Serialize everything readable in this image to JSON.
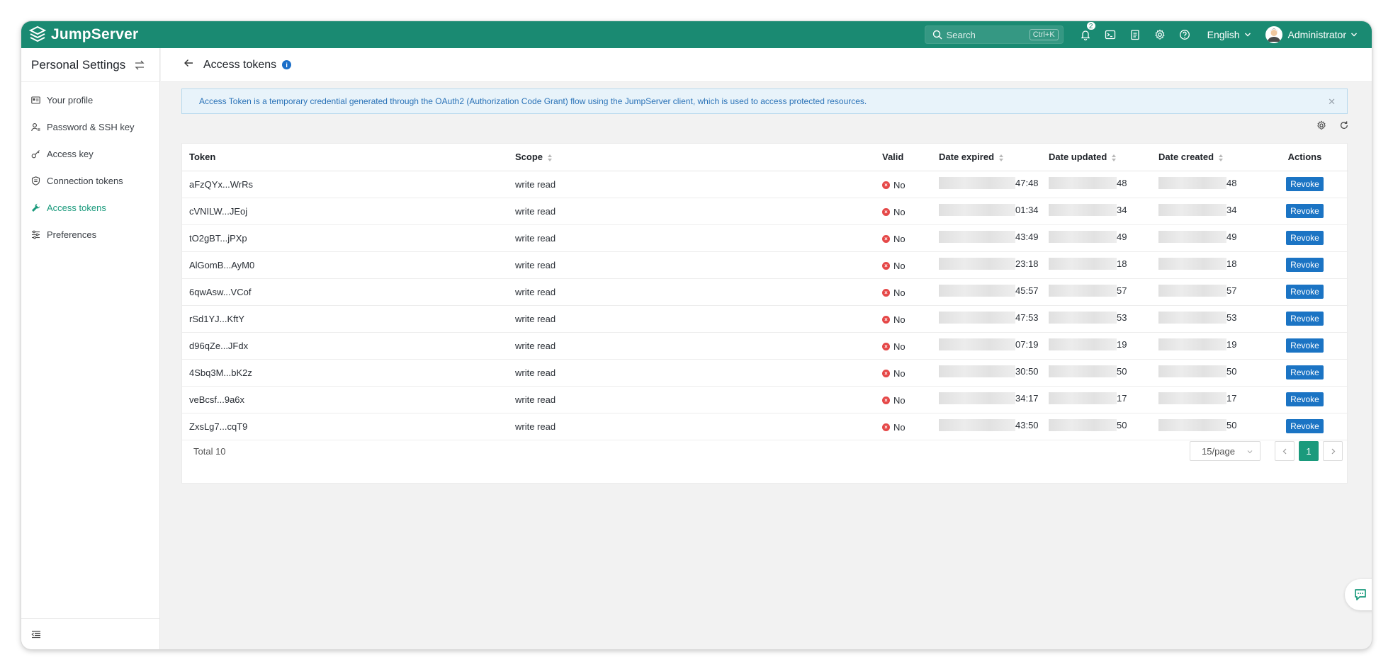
{
  "app": {
    "brand": "JumpServer"
  },
  "topbar": {
    "search_placeholder": "Search",
    "search_shortcut": "Ctrl+K",
    "notification_count": "2",
    "language": "English",
    "user": "Administrator"
  },
  "sidebar": {
    "title": "Personal Settings",
    "items": [
      {
        "label": "Your profile",
        "icon": "id-card-icon"
      },
      {
        "label": "Password & SSH key",
        "icon": "user-key-icon"
      },
      {
        "label": "Access key",
        "icon": "key-icon"
      },
      {
        "label": "Connection tokens",
        "icon": "shield-icon"
      },
      {
        "label": "Access tokens",
        "icon": "wrench-icon",
        "active": true
      },
      {
        "label": "Preferences",
        "icon": "sliders-icon"
      }
    ]
  },
  "page": {
    "title": "Access tokens",
    "alert": "Access Token is a temporary credential generated through the OAuth2 (Authorization Code Grant) flow using the JumpServer client, which is used to access protected resources."
  },
  "table": {
    "columns": [
      "Token",
      "Scope",
      "Valid",
      "Date expired",
      "Date updated",
      "Date created",
      "Actions"
    ],
    "rows": [
      {
        "token": "aFzQYx...WrRs",
        "scope": "write read",
        "valid": "No",
        "expired": "47:48",
        "updated": "48",
        "created": "48",
        "action": "Revoke"
      },
      {
        "token": "cVNILW...JEoj",
        "scope": "write read",
        "valid": "No",
        "expired": "01:34",
        "updated": "34",
        "created": "34",
        "action": "Revoke"
      },
      {
        "token": "tO2gBT...jPXp",
        "scope": "write read",
        "valid": "No",
        "expired": "43:49",
        "updated": "49",
        "created": "49",
        "action": "Revoke"
      },
      {
        "token": "AlGomB...AyM0",
        "scope": "write read",
        "valid": "No",
        "expired": "23:18",
        "updated": "18",
        "created": "18",
        "action": "Revoke"
      },
      {
        "token": "6qwAsw...VCof",
        "scope": "write read",
        "valid": "No",
        "expired": "45:57",
        "updated": "57",
        "created": "57",
        "action": "Revoke"
      },
      {
        "token": "rSd1YJ...KftY",
        "scope": "write read",
        "valid": "No",
        "expired": "47:53",
        "updated": "53",
        "created": "53",
        "action": "Revoke"
      },
      {
        "token": "d96qZe...JFdx",
        "scope": "write read",
        "valid": "No",
        "expired": "07:19",
        "updated": "19",
        "created": "19",
        "action": "Revoke"
      },
      {
        "token": "4Sbq3M...bK2z",
        "scope": "write read",
        "valid": "No",
        "expired": "30:50",
        "updated": "50",
        "created": "50",
        "action": "Revoke"
      },
      {
        "token": "veBcsf...9a6x",
        "scope": "write read",
        "valid": "No",
        "expired": "34:17",
        "updated": "17",
        "created": "17",
        "action": "Revoke"
      },
      {
        "token": "ZxsLg7...cqT9",
        "scope": "write read",
        "valid": "No",
        "expired": "43:50",
        "updated": "50",
        "created": "50",
        "action": "Revoke"
      }
    ]
  },
  "pagination": {
    "total": "Total 10",
    "page_size": "15/page",
    "current_page": "1"
  },
  "colors": {
    "brand": "#1a8a72",
    "accent": "#1a9a7c",
    "revoke": "#1b74c4",
    "error": "#e54848"
  }
}
